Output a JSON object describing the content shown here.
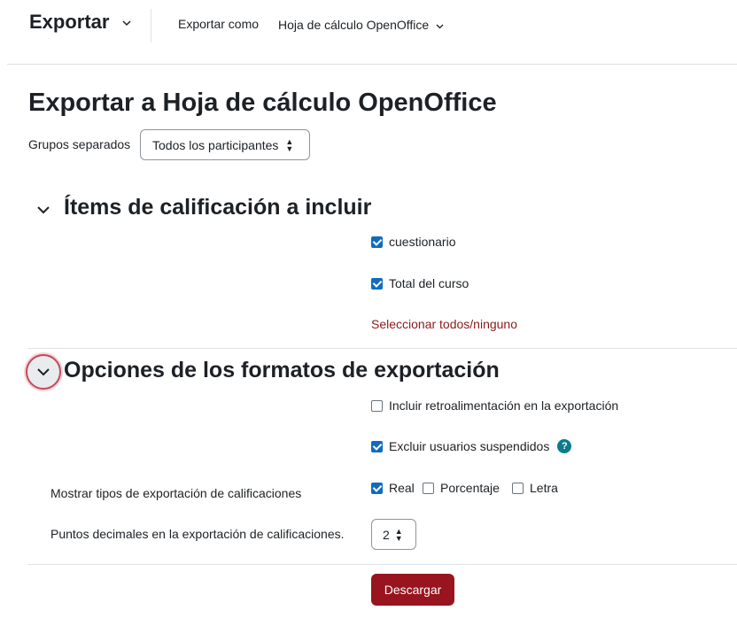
{
  "header": {
    "title": "Exportar",
    "export_as_label": "Exportar como",
    "export_format": "Hoja de cálculo OpenOffice"
  },
  "page_title": "Exportar a Hoja de cálculo OpenOffice",
  "groups": {
    "label": "Grupos separados",
    "selected": "Todos los participantes"
  },
  "section_items": {
    "title": "Ítems de calificación a incluir",
    "items": [
      {
        "label": "cuestionario",
        "checked": true
      },
      {
        "label": "Total del curso",
        "checked": true
      }
    ],
    "select_all_link": "Seleccionar todos/ninguno"
  },
  "section_options": {
    "title": "Opciones de los formatos de exportación",
    "include_feedback": {
      "label": "Incluir retroalimentación en la exportación",
      "checked": false
    },
    "exclude_suspended": {
      "label": "Excluir usuarios suspendidos",
      "checked": true
    },
    "display_types": {
      "label": "Mostrar tipos de exportación de calificaciones",
      "options": [
        {
          "label": "Real",
          "checked": true
        },
        {
          "label": "Porcentaje",
          "checked": false
        },
        {
          "label": "Letra",
          "checked": false
        }
      ]
    },
    "decimal_points": {
      "label": "Puntos decimales en la exportación de calificaciones.",
      "value": "2"
    }
  },
  "submit_label": "Descargar",
  "icons": {
    "help": "help-icon",
    "chevron": "chevron-down-icon"
  },
  "colors": {
    "accent": "#0f6cbf",
    "primary_button": "#98141f",
    "link": "#8a1b1b",
    "help": "#0a7c8c"
  }
}
